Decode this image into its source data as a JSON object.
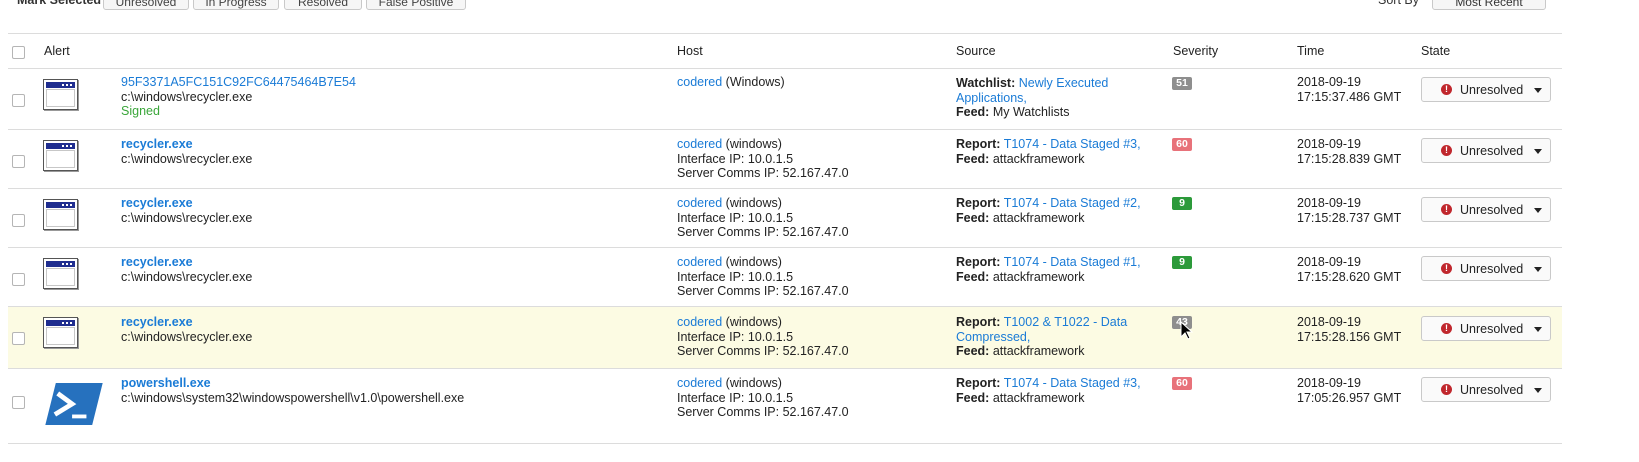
{
  "toolbar": {
    "mark_selected_label": "Mark Selected",
    "buttons": [
      "Unresolved",
      "In Progress",
      "Resolved",
      "False Positive"
    ],
    "sort_by_label": "Sort By",
    "sort_value": "Most Recent"
  },
  "columns": {
    "alert": "Alert",
    "host": "Host",
    "source": "Source",
    "severity": "Severity",
    "time": "Time",
    "state": "State"
  },
  "rows": [
    {
      "icon": "application-window-icon",
      "name": "95F3371A5FC151C92FC64475464B7E54",
      "path": "c:\\windows\\recycler.exe",
      "signed": "Signed",
      "host_name": "codered",
      "host_os": "(Windows)",
      "interface_ip": "",
      "server_ip": "",
      "source_key": "Watchlist:",
      "source_link_1": "Newly Executed",
      "source_link_2": "Applications,",
      "feed_key": "Feed:",
      "feed_value": "My Watchlists",
      "severity": "51",
      "severity_color": "#8e8e8e",
      "date": "2018-09-19",
      "time": "17:15:37.486 GMT",
      "state": "Unresolved"
    },
    {
      "icon": "application-window-icon",
      "name": "recycler.exe",
      "path": "c:\\windows\\recycler.exe",
      "host_name": "codered",
      "host_os": "(windows)",
      "interface_ip": "Interface IP: 10.0.1.5",
      "server_ip": "Server Comms IP: 52.167.47.0",
      "source_key": "Report:",
      "source_link_1": "T1074 - Data Staged #3,",
      "feed_key": "Feed:",
      "feed_value": "attackframework",
      "severity": "60",
      "severity_color": "#e8727a",
      "date": "2018-09-19",
      "time": "17:15:28.839 GMT",
      "state": "Unresolved"
    },
    {
      "icon": "application-window-icon",
      "name": "recycler.exe",
      "path": "c:\\windows\\recycler.exe",
      "host_name": "codered",
      "host_os": "(windows)",
      "interface_ip": "Interface IP: 10.0.1.5",
      "server_ip": "Server Comms IP: 52.167.47.0",
      "source_key": "Report:",
      "source_link_1": "T1074 - Data Staged #2,",
      "feed_key": "Feed:",
      "feed_value": "attackframework",
      "severity": "9",
      "severity_color": "#2c9a3a",
      "date": "2018-09-19",
      "time": "17:15:28.737 GMT",
      "state": "Unresolved"
    },
    {
      "icon": "application-window-icon",
      "name": "recycler.exe",
      "path": "c:\\windows\\recycler.exe",
      "host_name": "codered",
      "host_os": "(windows)",
      "interface_ip": "Interface IP: 10.0.1.5",
      "server_ip": "Server Comms IP: 52.167.47.0",
      "source_key": "Report:",
      "source_link_1": "T1074 - Data Staged #1,",
      "feed_key": "Feed:",
      "feed_value": "attackframework",
      "severity": "9",
      "severity_color": "#2c9a3a",
      "date": "2018-09-19",
      "time": "17:15:28.620 GMT",
      "state": "Unresolved"
    },
    {
      "icon": "application-window-icon",
      "name": "recycler.exe",
      "path": "c:\\windows\\recycler.exe",
      "host_name": "codered",
      "host_os": "(windows)",
      "interface_ip": "Interface IP: 10.0.1.5",
      "server_ip": "Server Comms IP: 52.167.47.0",
      "source_key": "Report:",
      "source_link_1": "T1002 & T1022 - Data",
      "source_link_2": "Compressed,",
      "feed_key": "Feed:",
      "feed_value": "attackframework",
      "severity": "43",
      "severity_color": "#8e8e8e",
      "date": "2018-09-19",
      "time": "17:15:28.156 GMT",
      "state": "Unresolved"
    },
    {
      "icon": "powershell-icon",
      "name": "powershell.exe",
      "path": "c:\\windows\\system32\\windowspowershell\\v1.0\\powershell.exe",
      "host_name": "codered",
      "host_os": "(windows)",
      "interface_ip": "Interface IP: 10.0.1.5",
      "server_ip": "Server Comms IP: 52.167.47.0",
      "source_key": "Report:",
      "source_link_1": "T1074 - Data Staged #3,",
      "feed_key": "Feed:",
      "feed_value": "attackframework",
      "severity": "60",
      "severity_color": "#e8727a",
      "date": "2018-09-19",
      "time": "17:05:26.957 GMT",
      "state": "Unresolved"
    }
  ],
  "colors": {
    "link": "#1a7bd6",
    "signed": "#3aa63a",
    "highlight_row": "#fcfbe3",
    "alert_red": "#c0272d"
  }
}
